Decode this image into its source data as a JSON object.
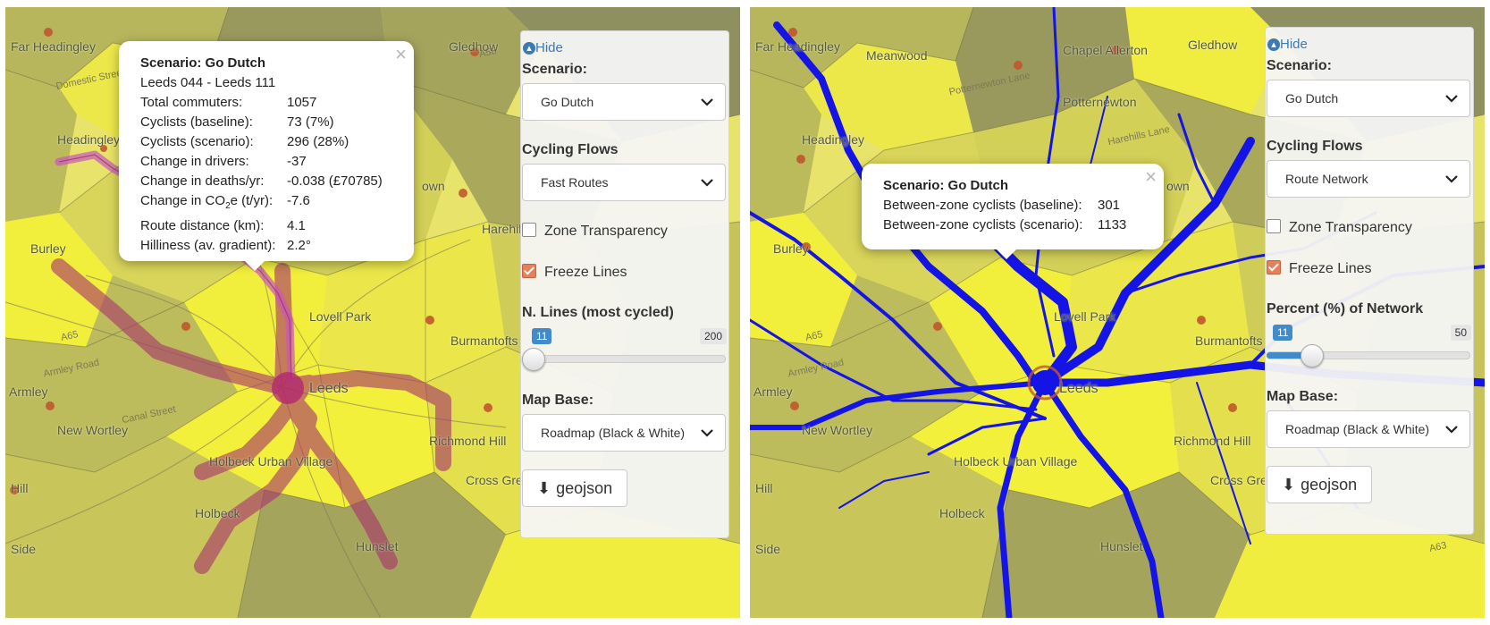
{
  "panels": {
    "left": {
      "map_labels": [
        "Far Headingley",
        "Headingley",
        "Burley",
        "Armley",
        "New Wortley",
        "Lovell Park",
        "Burmantofts",
        "Richmond Hill",
        "Holbeck Urban Village",
        "Holbeck",
        "Hunslet",
        "Cross Green",
        "Gledhow",
        "Harehills",
        "Hill",
        "Side",
        "Leeds",
        "own"
      ],
      "road_labels": [
        "A65",
        "A58",
        "Armley Road",
        "Canal Street",
        "Domestic Street"
      ],
      "popup": {
        "title": "Scenario: Go Dutch",
        "subtitle": "Leeds 044 - Leeds 111",
        "close_icon": "×",
        "rows": [
          {
            "label": "Total commuters:",
            "value": "1057"
          },
          {
            "label": "Cyclists (baseline):",
            "value": "73 (7%)"
          },
          {
            "label": "Cyclists (scenario):",
            "value": "296 (28%)"
          },
          {
            "label": "Change in drivers:",
            "value": "-37"
          },
          {
            "label": "Change in deaths/yr:",
            "value": "-0.038 (£70785)"
          },
          {
            "label_pre": "Change in CO",
            "label_sub": "2",
            "label_post": "e (t/yr):",
            "value": "-7.6"
          },
          {
            "label": "Route distance (km):",
            "value": "4.1"
          },
          {
            "label": "Hilliness (av. gradient):",
            "value": "2.2°"
          }
        ]
      },
      "controls": {
        "hide": "Hide",
        "scenario_label": "Scenario:",
        "scenario_value": "Go Dutch",
        "flows_label": "Cycling Flows",
        "flows_value": "Fast Routes",
        "zone_transparency": "Zone Transparency",
        "zone_transparency_checked": false,
        "freeze_lines": "Freeze Lines",
        "freeze_lines_checked": true,
        "slider_label": "N. Lines (most cycled)",
        "slider_value": "11",
        "slider_max": "200",
        "slider_fraction": 0.055,
        "map_base_label": "Map Base:",
        "map_base_value": "Roadmap (Black & White)",
        "download": "geojson"
      }
    },
    "right": {
      "map_labels": [
        "Far Headingley",
        "Meanwood",
        "Chapel Allerton",
        "Gledhow",
        "Potternewton",
        "Headingley",
        "Burley",
        "Armley",
        "New Wortley",
        "Lovell Park",
        "Burmantofts",
        "Richmond Hill",
        "Holbeck Urban Village",
        "Holbeck",
        "Hunslet",
        "Cross Green",
        "Hill",
        "Side",
        "Leeds",
        "own"
      ],
      "road_labels": [
        "A65",
        "A63",
        "Potternewton Lane",
        "Harehills Lane",
        "Armley Road"
      ],
      "popup": {
        "title": "Scenario: Go Dutch",
        "close_icon": "×",
        "rows": [
          {
            "label": "Between-zone cyclists (baseline):",
            "value": "301"
          },
          {
            "label": "Between-zone cyclists (scenario):",
            "value": "1133"
          }
        ]
      },
      "controls": {
        "hide": "Hide",
        "scenario_label": "Scenario:",
        "scenario_value": "Go Dutch",
        "flows_label": "Cycling Flows",
        "flows_value": "Route Network",
        "zone_transparency": "Zone Transparency",
        "zone_transparency_checked": false,
        "freeze_lines": "Freeze Lines",
        "freeze_lines_checked": true,
        "slider_label": "Percent (%) of Network",
        "slider_value": "11",
        "slider_max": "50",
        "slider_fraction": 0.22,
        "map_base_label": "Map Base:",
        "map_base_value": "Roadmap (Black & White)",
        "download": "geojson"
      }
    }
  },
  "colors": {
    "zone_high": "#f2ef3c",
    "zone_mid": "#d7d35a",
    "zone_low": "#a3a35d",
    "zone_lowest": "#8f9060",
    "route_line": "#a8376b",
    "route_selected": "#cc55b8",
    "network_line": "#1414e6",
    "centroid": "#c0562e",
    "accent": "#428bca"
  }
}
